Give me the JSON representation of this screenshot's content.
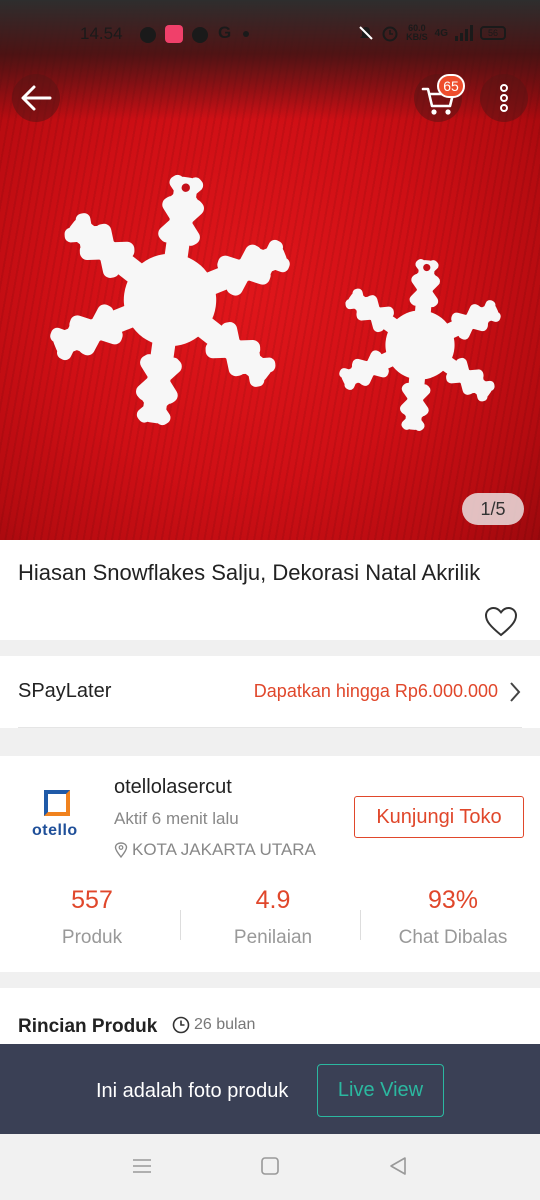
{
  "status_bar": {
    "time": "14.54",
    "google_glyph": "G",
    "net_speed": "60.0",
    "net_unit": "KB/S",
    "network_type": "4G",
    "battery": "56",
    "icons": [
      "facebook-messenger-icon",
      "app-notification-icon",
      "facebook-icon",
      "google-icon",
      "mute-bell-icon",
      "alarm-icon",
      "signal-icon",
      "battery-icon"
    ]
  },
  "header": {
    "cart_count": "65",
    "icons": [
      "back-arrow-icon",
      "cart-icon",
      "more-vertical-icon"
    ]
  },
  "gallery": {
    "counter": "1/5",
    "colors": {
      "background": "#d0111a",
      "snowflake": "#f7f7f7"
    }
  },
  "product": {
    "title": "Hiasan Snowflakes Salju, Dekorasi Natal Akrilik",
    "wishlist_icon": "heart-outline-icon"
  },
  "spaylater": {
    "label": "SPayLater",
    "promo": "Dapatkan hingga Rp6.000.000"
  },
  "shop": {
    "logo_text": "otello",
    "name": "otellolasercut",
    "active_status": "Aktif 6 menit lalu",
    "location": "KOTA JAKARTA UTARA",
    "visit_label": "Kunjungi Toko",
    "stats": [
      {
        "value": "557",
        "label": "Produk"
      },
      {
        "value": "4.9",
        "label": "Penilaian"
      },
      {
        "value": "93%",
        "label": "Chat Dibalas"
      }
    ]
  },
  "details": {
    "heading": "Rincian Produk",
    "age": "26 bulan"
  },
  "banner": {
    "message": "Ini adalah foto produk",
    "live_view_label": "Live View"
  },
  "colors": {
    "accent": "#e0472b",
    "banner_bg": "#3a4055",
    "live_view": "#2bb8a0"
  },
  "nav_bar": {
    "icons": [
      "menu-icon",
      "home-square-icon",
      "back-triangle-icon"
    ]
  }
}
